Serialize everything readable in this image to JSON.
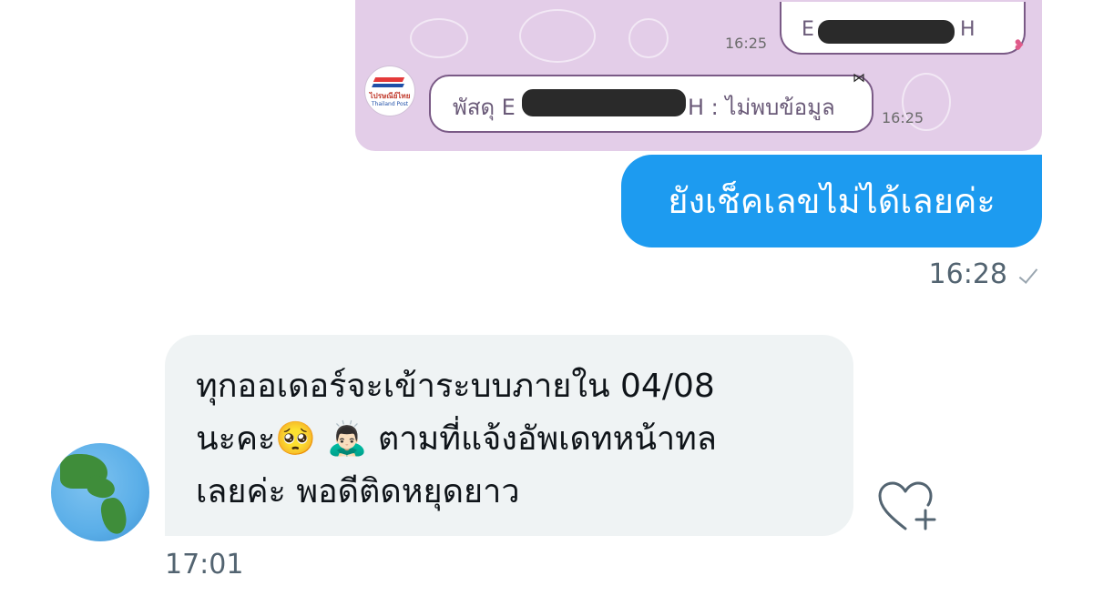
{
  "embedded_screenshot": {
    "outgoing_prefix": "E",
    "outgoing_suffix": "H",
    "outgoing_time": "16:25",
    "incoming_text_prefix": "พัสดุ E",
    "incoming_text_suffix": "H : ไม่พบข้อมูล",
    "incoming_time": "16:25",
    "sender_logo_text": "ไปรษณีย์ไทย",
    "sender_logo_sub": "Thailand Post"
  },
  "sent_message": {
    "text": "ยังเช็คเลขไม่ได้เลยค่ะ",
    "time": "16:28",
    "status_icon": "check-icon"
  },
  "received_message": {
    "lines": [
      "ทุกออเดอร์จะเข้าระบบภายใน 04/08",
      "นะคะ🥺 🙇🏻‍♂️  ตามที่แจ้งอัพเดทหน้าทล",
      "เลยค่ะ พอดีติดหยุดยาว"
    ],
    "time": "17:01",
    "avatar_icon": "globe-americas-icon",
    "reaction_icon": "heart-plus-icon"
  },
  "colors": {
    "sent_bubble": "#1d9bf0",
    "received_bubble": "#eff3f4",
    "meta_text": "#536471",
    "embedded_bg": "#e3cde8"
  }
}
